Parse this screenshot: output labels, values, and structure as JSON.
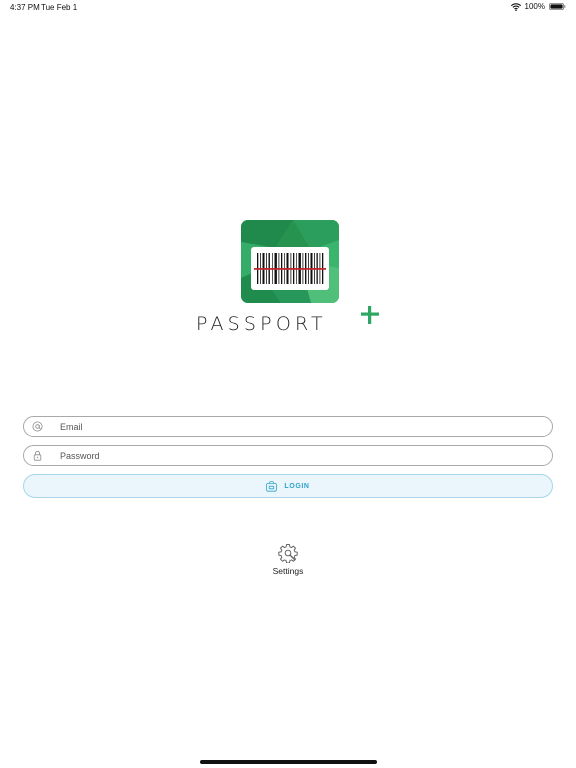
{
  "status_bar": {
    "time": "4:37 PM",
    "date": "Tue Feb 1",
    "battery": "100%",
    "icons": [
      "wifi-icon",
      "battery-icon"
    ]
  },
  "logo": {
    "word": "PASSPORT",
    "plus_icon": "plus-icon",
    "tile_icon": "barcode-icon",
    "colors": {
      "green_dark": "#1f8a4c",
      "green": "#2ea663",
      "green_light": "#53c07c",
      "scan_line": "#c0262b"
    }
  },
  "form": {
    "email": {
      "placeholder": "Email",
      "value": "",
      "icon": "at-icon"
    },
    "password": {
      "placeholder": "Password",
      "value": "",
      "icon": "lock-icon"
    },
    "login": {
      "label": "LOGIN",
      "icon": "login-icon",
      "accent": "#2fa3c8"
    }
  },
  "settings": {
    "label": "Settings",
    "icon": "gear-icon"
  }
}
